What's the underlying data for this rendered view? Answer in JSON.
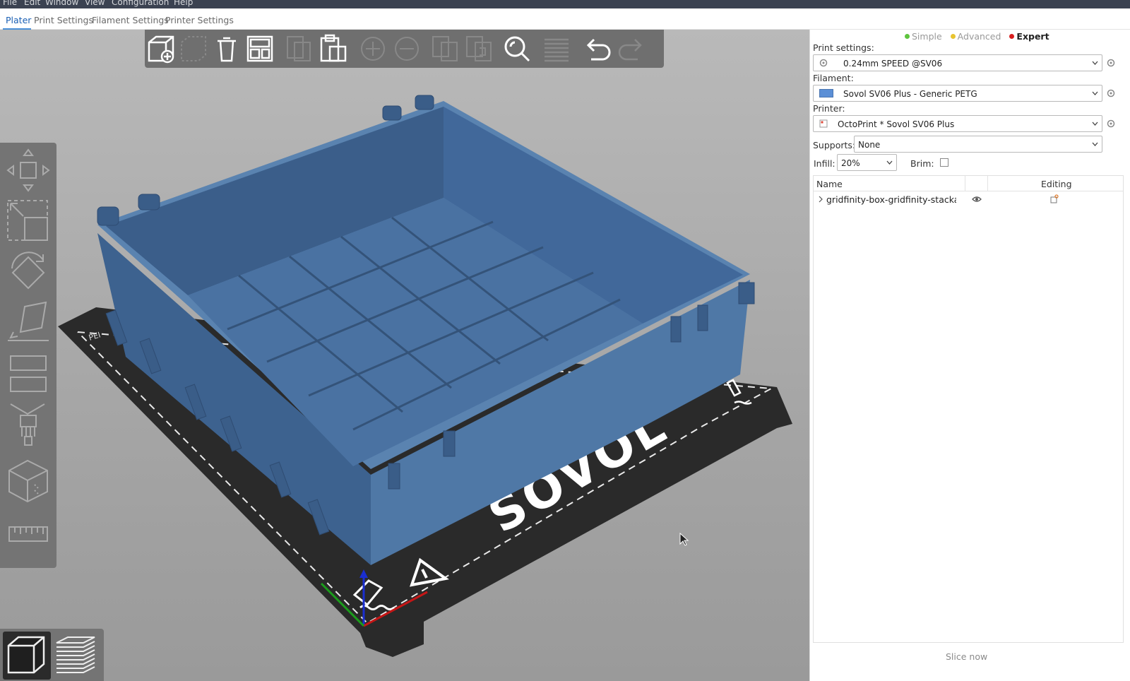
{
  "menu": {
    "items": [
      "File",
      "Edit",
      "Window",
      "View",
      "Configuration",
      "Help"
    ]
  },
  "tabs": [
    "Plater",
    "Print Settings",
    "Filament Settings",
    "Printer Settings"
  ],
  "active_tab": "Plater",
  "toolbar": {
    "icons": [
      "add-icon",
      "delete-icon",
      "delete-all-icon",
      "arrange-icon",
      "copy-icon",
      "paste-icon",
      "add-instance-icon",
      "remove-instance-icon",
      "split-objects-icon",
      "split-parts-icon",
      "search-icon",
      "variable-layer-height-icon",
      "undo-icon",
      "redo-icon"
    ]
  },
  "left_toolbar": {
    "icons": [
      "move-icon",
      "scale-icon",
      "rotate-icon",
      "place-on-face-icon",
      "cut-icon",
      "paint-supports-icon",
      "seam-painting-icon",
      "measure-icon"
    ]
  },
  "view_toggle": {
    "icons": [
      "3d-view-icon",
      "preview-layers-icon"
    ]
  },
  "bed": {
    "brand": "SOVOL",
    "corner_label": "PEI"
  },
  "panel": {
    "modes": [
      {
        "label": "Simple",
        "color": "#5ec43e",
        "active": false
      },
      {
        "label": "Advanced",
        "color": "#e8c430",
        "active": false
      },
      {
        "label": "Expert",
        "color": "#d81e1e",
        "active": true
      }
    ],
    "print_settings_label": "Print settings:",
    "print_settings_value": "0.24mm SPEED @SV06",
    "filament_label": "Filament:",
    "filament_value": "Sovol SV06 Plus - Generic PETG",
    "filament_color": "#5b8fd6",
    "printer_label": "Printer:",
    "printer_value": "OctoPrint * Sovol SV06 Plus",
    "supports_label": "Supports:",
    "supports_value": "None",
    "infill_label": "Infill:",
    "infill_value": "20%",
    "brim_label": "Brim:",
    "brim_checked": false,
    "list_headers": {
      "name": "Name",
      "editing": "Editing"
    },
    "objects": [
      {
        "name": "gridfinity-box-gridfinity-stackable-("
      }
    ],
    "slice_now": "Slice now"
  }
}
